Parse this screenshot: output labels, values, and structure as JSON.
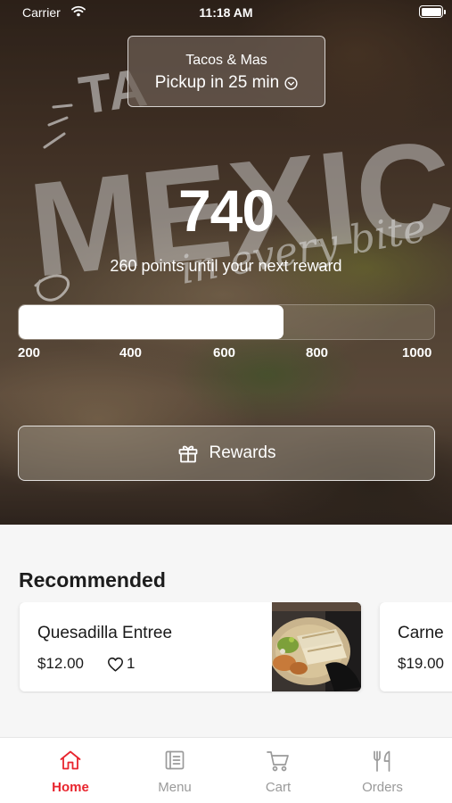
{
  "status_bar": {
    "carrier": "Carrier",
    "time": "11:18 AM"
  },
  "location": {
    "store_name": "Tacos & Mas",
    "pickup_text": "Pickup in 25 min"
  },
  "hero_watermark": {
    "line1": "TA",
    "line2": "MEXIC",
    "line3": "in every bite"
  },
  "rewards": {
    "points": "740",
    "caption": "260 points until your next reward",
    "progress_fraction": 0.638,
    "ticks": [
      "200",
      "400",
      "600",
      "800",
      "1000"
    ],
    "button_label": "Rewards"
  },
  "recommended": {
    "title": "Recommended",
    "items": [
      {
        "name": "Quesadilla Entree",
        "price": "$12.00",
        "likes": "1"
      },
      {
        "name": "Carne",
        "price": "$19.00"
      }
    ]
  },
  "tab_bar": {
    "tabs": [
      {
        "label": "Home",
        "icon": "home-icon",
        "active": true
      },
      {
        "label": "Menu",
        "icon": "menu-icon",
        "active": false
      },
      {
        "label": "Cart",
        "icon": "cart-icon",
        "active": false
      },
      {
        "label": "Orders",
        "icon": "orders-icon",
        "active": false
      }
    ]
  },
  "colors": {
    "accent": "#e8252e",
    "inactive_tab": "#9a9a9a",
    "background": "#f6f6f6"
  }
}
